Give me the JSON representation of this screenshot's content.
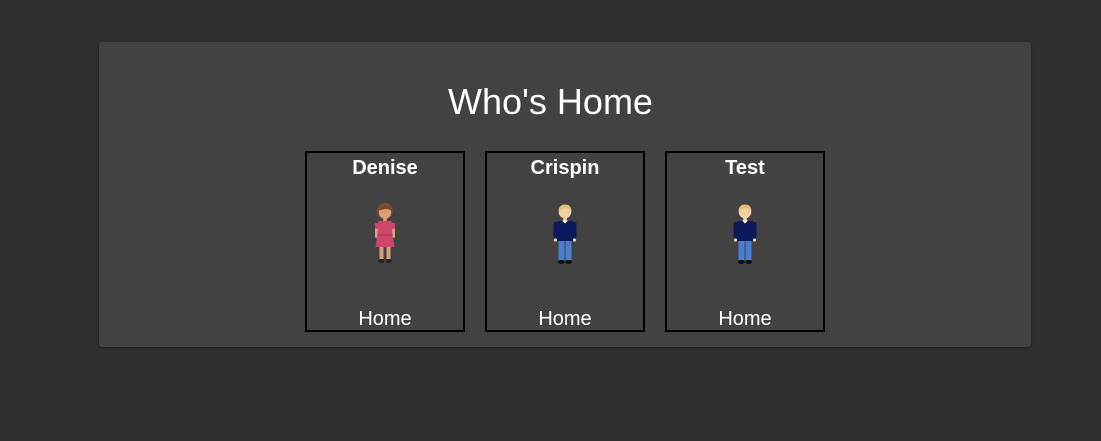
{
  "card": {
    "title": "Who's Home"
  },
  "people": [
    {
      "name": "Denise",
      "status": "Home",
      "avatar": "girl-icon"
    },
    {
      "name": "Crispin",
      "status": "Home",
      "avatar": "boy-icon"
    },
    {
      "name": "Test",
      "status": "Home",
      "avatar": "boy-icon"
    }
  ],
  "colors": {
    "page_background": "#303030",
    "card_background": "#424242",
    "text": "#ffffff",
    "tile_border": "#000000"
  }
}
